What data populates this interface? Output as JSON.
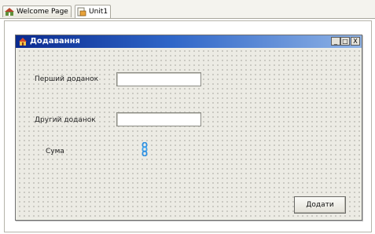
{
  "tabs": [
    {
      "label": "Welcome Page",
      "icon": "home-icon",
      "active": false
    },
    {
      "label": "Unit1",
      "icon": "unit-file-icon",
      "active": true
    }
  ],
  "form": {
    "title": "Додавання",
    "icon": "delphi-form-icon",
    "titlebar_buttons": [
      "_",
      "□",
      "X"
    ],
    "labels": {
      "first": "Перший доданок",
      "second": "Другий доданок",
      "sum": "Сума"
    },
    "inputs": {
      "first_value": "",
      "second_value": ""
    },
    "add_button": "Додати"
  },
  "colors": {
    "titlebar_start": "#0a2a8f",
    "titlebar_end": "#8fb3e6",
    "form_background": "#ecebe4"
  }
}
